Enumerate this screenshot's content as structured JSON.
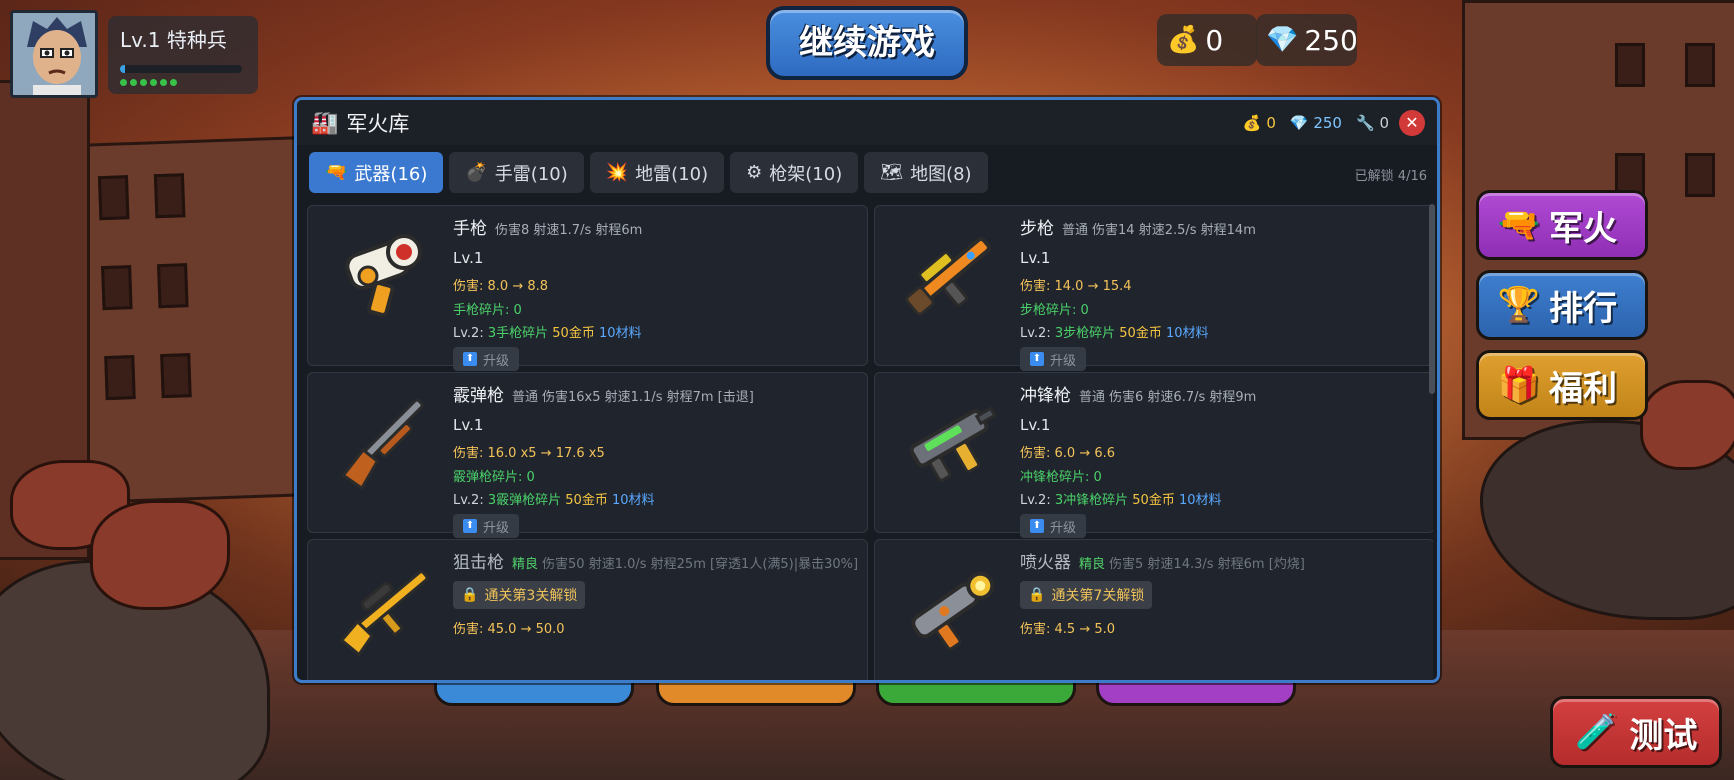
{
  "player": {
    "name": "Lv.1 特种兵",
    "xp_fraction": 0.04,
    "stars_count": 6
  },
  "top": {
    "continue_label": "继续游戏",
    "gold": "0",
    "gems": "250"
  },
  "side_buttons": {
    "arsenal": "军火",
    "ranking": "排行",
    "welfare": "福利",
    "test": "测试"
  },
  "panel": {
    "title": "军火库",
    "gold": "0",
    "gems": "250",
    "materials": "0",
    "close_symbol": "✕",
    "unlocked_text": "已解锁 4/16",
    "tabs": [
      {
        "label": "武器(16)",
        "icon": "pistol-icon",
        "active": true
      },
      {
        "label": "手雷(10)",
        "icon": "grenade-icon",
        "active": false
      },
      {
        "label": "地雷(10)",
        "icon": "mine-icon",
        "active": false
      },
      {
        "label": "枪架(10)",
        "icon": "gear-icon",
        "active": false
      },
      {
        "label": "地图(8)",
        "icon": "map-icon",
        "active": false
      }
    ],
    "weapons": [
      {
        "name": "手枪",
        "rarity": "",
        "stats": "伤害8 射速1.7/s 射程6m",
        "level": "Lv.1",
        "damage": "伤害: 8.0 → 8.8",
        "fragments": "手枪碎片: 0",
        "next_prefix": "Lv.2:",
        "next_frag": "3手枪碎片",
        "next_gold": "50金币",
        "next_mat": "10材料",
        "upgrade_label": "升级",
        "locked": false
      },
      {
        "name": "步枪",
        "rarity": "普通",
        "stats": "伤害14 射速2.5/s 射程14m",
        "level": "Lv.1",
        "damage": "伤害: 14.0 → 15.4",
        "fragments": "步枪碎片: 0",
        "next_prefix": "Lv.2:",
        "next_frag": "3步枪碎片",
        "next_gold": "50金币",
        "next_mat": "10材料",
        "upgrade_label": "升级",
        "locked": false
      },
      {
        "name": "霰弹枪",
        "rarity": "普通",
        "stats": "伤害16x5 射速1.1/s 射程7m [击退]",
        "level": "Lv.1",
        "damage": "伤害: 16.0 x5 → 17.6 x5",
        "fragments": "霰弹枪碎片: 0",
        "next_prefix": "Lv.2:",
        "next_frag": "3霰弹枪碎片",
        "next_gold": "50金币",
        "next_mat": "10材料",
        "upgrade_label": "升级",
        "locked": false
      },
      {
        "name": "冲锋枪",
        "rarity": "普通",
        "stats": "伤害6 射速6.7/s 射程9m",
        "level": "Lv.1",
        "damage": "伤害: 6.0 → 6.6",
        "fragments": "冲锋枪碎片: 0",
        "next_prefix": "Lv.2:",
        "next_frag": "3冲锋枪碎片",
        "next_gold": "50金币",
        "next_mat": "10材料",
        "upgrade_label": "升级",
        "locked": false
      },
      {
        "name": "狙击枪",
        "rarity": "精良",
        "stats": "伤害50 射速1.0/s 射程25m [穿透1人(满5)|暴击30%]",
        "lock_text": "通关第3关解锁",
        "damage": "伤害: 45.0 → 50.0",
        "locked": true
      },
      {
        "name": "喷火器",
        "rarity": "精良",
        "stats": "伤害5 射速14.3/s 射程6m [灼烧]",
        "lock_text": "通关第7关解锁",
        "damage": "伤害: 4.5 → 5.0",
        "locked": true
      }
    ]
  },
  "colors": {
    "panel_border": "#3c7cc9",
    "tab_active": "#3b78d0",
    "gold_text": "#f4c35a",
    "fragment_text": "#4ad16a",
    "material_text": "#5aa9ff",
    "close_red": "#d23a3a"
  }
}
